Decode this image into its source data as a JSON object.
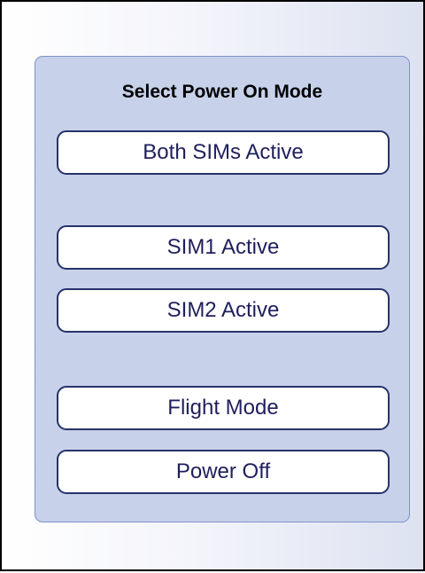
{
  "dialog": {
    "title": "Select Power On Mode",
    "options": [
      "Both SIMs Active",
      "SIM1 Active",
      "SIM2 Active",
      "Flight Mode",
      "Power Off"
    ]
  },
  "colors": {
    "panel_background": "#c7d1ea",
    "panel_border": "#7f93c6",
    "button_border": "#27336a",
    "button_text": "#1f1f5c"
  }
}
